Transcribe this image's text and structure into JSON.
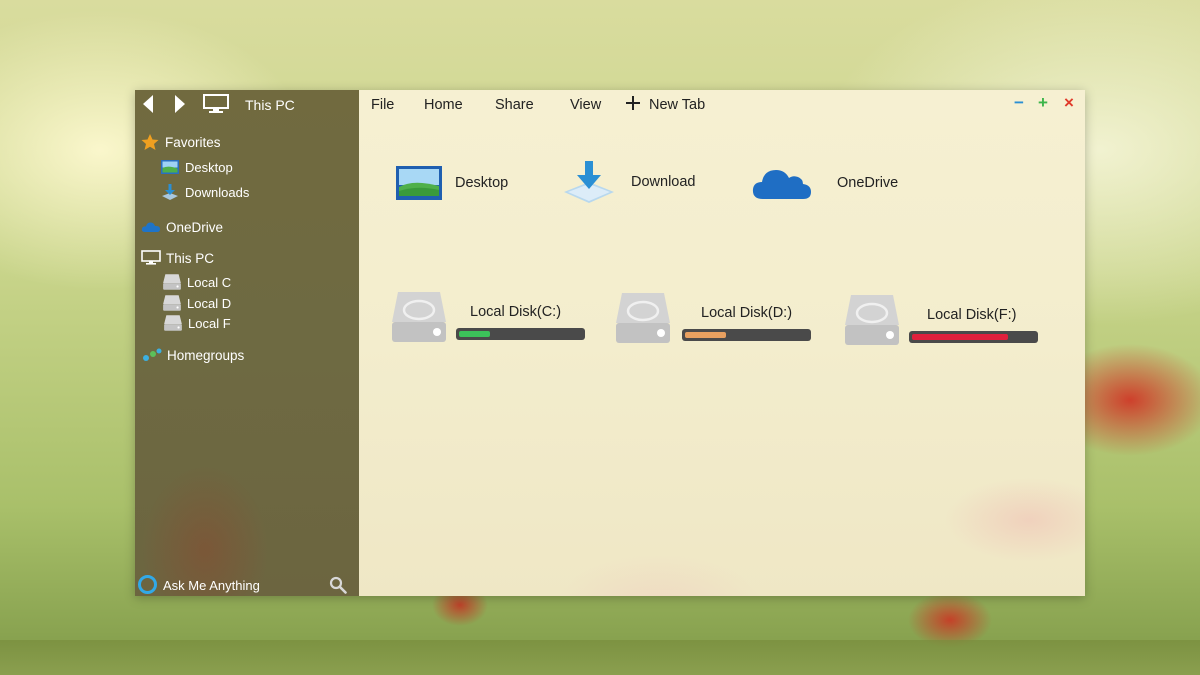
{
  "sidebar": {
    "nav_title": "This PC",
    "favorites_label": "Favorites",
    "items": {
      "desktop": "Desktop",
      "downloads": "Downloads",
      "onedrive": "OneDrive",
      "this_pc": "This PC",
      "local_c": "Local C",
      "local_d": "Local D",
      "local_f": "Local F",
      "homegroups": "Homegroups"
    },
    "ask_label": "Ask Me Anything"
  },
  "menu": {
    "file": "File",
    "home": "Home",
    "share": "Share",
    "view": "View",
    "new_tab": "New Tab"
  },
  "window_controls": {
    "minimize": "−",
    "maximize": "+",
    "close": "×"
  },
  "quick_access": [
    {
      "label": "Desktop",
      "icon": "desktop-picture-icon"
    },
    {
      "label": "Download",
      "icon": "download-arrow-icon"
    },
    {
      "label": "OneDrive",
      "icon": "onedrive-cloud-icon"
    }
  ],
  "drives": [
    {
      "label": "Local Disk(C:)",
      "used_fraction": 0.25,
      "color": "#3cc15a"
    },
    {
      "label": "Local Disk(D:)",
      "used_fraction": 0.33,
      "color": "#e8a060"
    },
    {
      "label": "Local Disk(F:)",
      "used_fraction": 0.78,
      "color": "#e0203c"
    }
  ],
  "colors": {
    "accent_blue": "#1f74c8",
    "minimize": "#2a8fd4",
    "maximize": "#3cb54a",
    "close": "#e03a2a"
  }
}
